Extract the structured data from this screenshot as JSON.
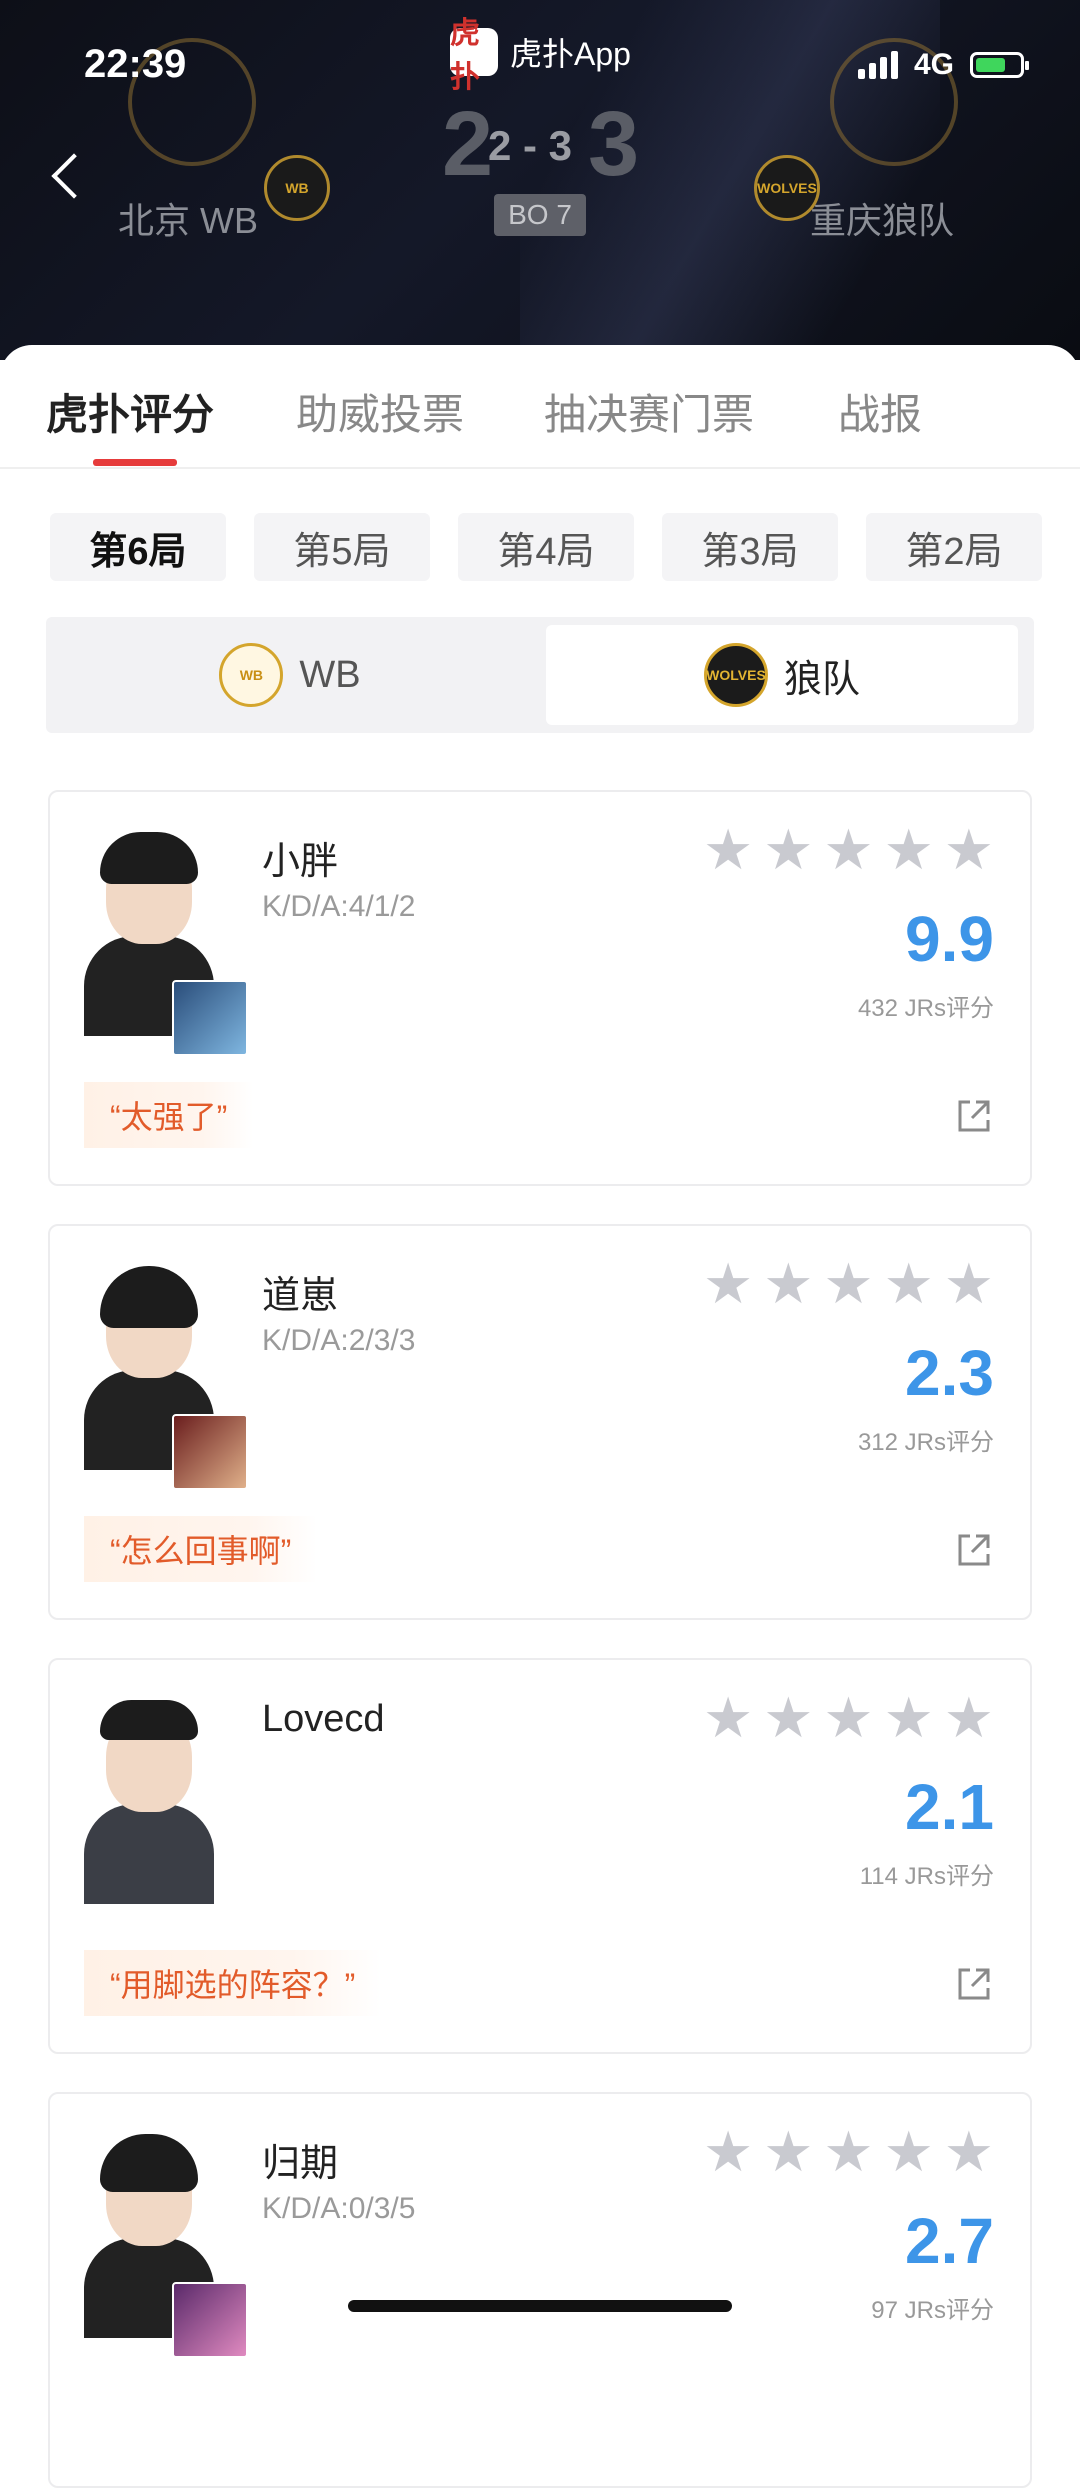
{
  "status_bar": {
    "time": "22:39",
    "network": "4G"
  },
  "app_badge": {
    "icon_text": "虎扑",
    "name": "虎扑App"
  },
  "match": {
    "home": {
      "name": "北京 WB",
      "logo_text": "WB"
    },
    "away": {
      "name": "重庆狼队",
      "logo_text": "WOLVES"
    },
    "score_big_home": "2",
    "score_big_away": "3",
    "score_small": "2 - 3",
    "format": "BO 7"
  },
  "tabs": [
    {
      "label": "虎扑评分",
      "active": true
    },
    {
      "label": "助威投票",
      "active": false
    },
    {
      "label": "抽决赛门票",
      "active": false
    },
    {
      "label": "战报",
      "active": false
    }
  ],
  "games": [
    {
      "label": "第6局",
      "active": true
    },
    {
      "label": "第5局",
      "active": false
    },
    {
      "label": "第4局",
      "active": false
    },
    {
      "label": "第3局",
      "active": false
    },
    {
      "label": "第2局",
      "active": false
    }
  ],
  "team_switch": {
    "left": {
      "label": "WB",
      "logo_text": "WB"
    },
    "right": {
      "label": "狼队",
      "logo_text": "WOLVES",
      "selected": true
    }
  },
  "players": [
    {
      "name": "小胖",
      "kda": "K/D/A:4/1/2",
      "score": "9.9",
      "votes": "432 JRs评分",
      "quote": "“太强了”"
    },
    {
      "name": "道崽",
      "kda": "K/D/A:2/3/3",
      "score": "2.3",
      "votes": "312 JRs评分",
      "quote": "“怎么回事啊”"
    },
    {
      "name": "Lovecd",
      "kda": "",
      "score": "2.1",
      "votes": "114 JRs评分",
      "quote": "“用脚选的阵容？”"
    },
    {
      "name": "归期",
      "kda": "K/D/A:0/3/5",
      "score": "2.7",
      "votes": "97 JRs评分",
      "quote": ""
    }
  ],
  "colors": {
    "accent_red": "#e63b3b",
    "score_blue": "#3d95e8",
    "quote_orange": "#e25b2a",
    "star_grey": "#c9cad0"
  },
  "icons": [
    "back-icon",
    "signal-icon",
    "battery-icon",
    "star-icon",
    "share-icon"
  ]
}
